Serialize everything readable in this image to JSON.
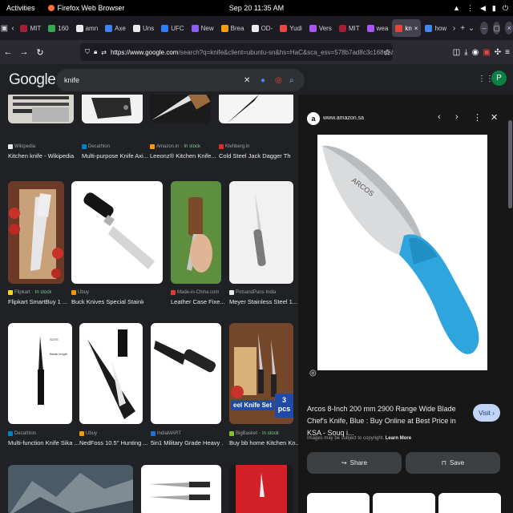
{
  "topbar": {
    "activities": "Activities",
    "app_name": "Firefox Web Browser",
    "clock": "Sep 20  11:35 AM"
  },
  "tabs": [
    {
      "label": "MIT",
      "color": "#a31f34"
    },
    {
      "label": "160",
      "color": "#34a853"
    },
    {
      "label": "amn",
      "color": "#e8eaed"
    },
    {
      "label": "Axe",
      "color": "#3b82f6"
    },
    {
      "label": "Uns",
      "color": "#e8eaed"
    },
    {
      "label": "UFC",
      "color": "#2d7ff9"
    },
    {
      "label": "New",
      "color": "#8b5cf6"
    },
    {
      "label": "Brea",
      "color": "#f59e0b"
    },
    {
      "label": "OD-",
      "color": "#e8eaed"
    },
    {
      "label": "Yudi",
      "color": "#ef4444"
    },
    {
      "label": "Vers",
      "color": "#a855f7"
    },
    {
      "label": "MIT",
      "color": "#a31f34"
    },
    {
      "label": "wea",
      "color": "#a855f7"
    },
    {
      "label": "kn",
      "color": "#ea4335",
      "active": true
    },
    {
      "label": "how",
      "color": "#4285f4"
    }
  ],
  "nav": {
    "url_host": "https://www.google.com",
    "url_path": "/search?q=knife&client=ubuntu-sn&hs=HaC&sca_esv=578b7ad8c3c168d5&sca_up"
  },
  "google": {
    "logo": "Google",
    "query": "knife",
    "avatar": "P"
  },
  "results": [
    {
      "source": "Wikipedia",
      "title": "Kitchen knife - Wikipedia",
      "stock": "",
      "fav": "#e8eaed"
    },
    {
      "source": "Decathlon",
      "title": "Multi-purpose Knife Axi...",
      "stock": "",
      "fav": "#0082c3"
    },
    {
      "source": "Amazon.in",
      "title": "Leeonz® Kitchen Knife...",
      "stock": "In stock",
      "fav": "#ff9900"
    },
    {
      "source": "Klehberg.in",
      "title": "Cold Steel Jack Dagger Thro...",
      "stock": "",
      "fav": "#d93025"
    },
    {
      "source": "Flipkart",
      "title": "Flipkart SmartBuy 1 ...",
      "stock": "In stock",
      "fav": "#f9d71c"
    },
    {
      "source": "Ubuy",
      "title": "Buck Knives Special Stainless Steel ...",
      "stock": "",
      "fav": "#f29900"
    },
    {
      "source": "Made-in-China.com",
      "title": "Leather Case Fixe...",
      "stock": "",
      "fav": "#e53935"
    },
    {
      "source": "PotsandPans India",
      "title": "Meyer Stainless Steel 1...",
      "stock": "",
      "fav": "#e8eaed"
    },
    {
      "source": "Decathlon",
      "title": "Multi-function Knife Sika ...",
      "stock": "",
      "fav": "#0082c3"
    },
    {
      "source": "Ubuy",
      "title": "NedFoss 10.5\" Hunting ...",
      "stock": "",
      "fav": "#f29900"
    },
    {
      "source": "IndiaMART",
      "title": "5in1 Military Grade Heavy ...",
      "stock": "",
      "fav": "#1976d2"
    },
    {
      "source": "BigBasket",
      "title": "Buy bb home Kitchen Kn...",
      "stock": "In stock",
      "fav": "#84c225"
    }
  ],
  "thumb_text": {
    "knife_set": "eel Knife Set",
    "pcs_count": "3",
    "pcs_unit": "pcs"
  },
  "panel": {
    "domain": "www.amazon.sa",
    "brand_on_blade": "ARCOS",
    "title": "Arcos 8-Inch 200 mm 2900 Range Wide Blade Chef's Knife, Blue : Buy Online at Best Price in KSA - Souq i...",
    "visit": "Visit",
    "copyright": "Images may be subject to copyright.",
    "learn_more": "Learn More",
    "share": "Share",
    "save": "Save"
  }
}
